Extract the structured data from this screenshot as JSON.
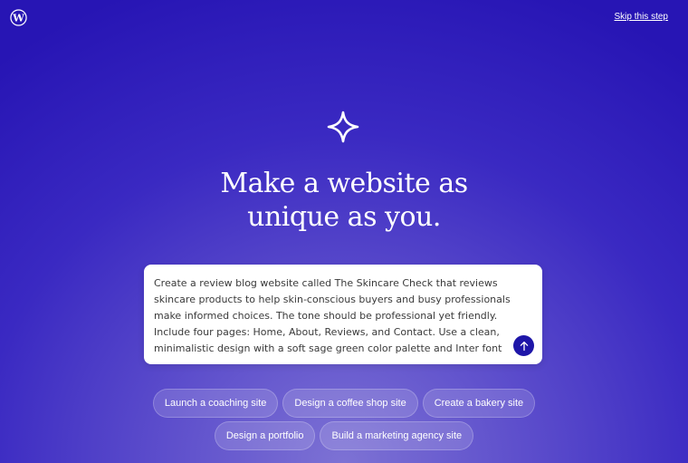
{
  "header": {
    "logo_icon": "wordpress-logo-icon",
    "skip_label": "Skip this step"
  },
  "hero": {
    "icon": "sparkle-icon",
    "headline_line1": "Make a website as",
    "headline_line2": "unique as you."
  },
  "prompt": {
    "value": "Create a review blog website called The Skincare Check that reviews skincare products to help skin-conscious buyers and busy professionals make informed choices. The tone should be professional yet friendly. Include four pages: Home, About, Reviews, and Contact. Use a clean, minimalistic design with a soft sage green color palette and Inter font throughout the site.",
    "submit_icon": "arrow-up-icon"
  },
  "suggestions": {
    "row1": [
      {
        "label": "Launch a coaching site"
      },
      {
        "label": "Design a coffee shop site"
      },
      {
        "label": "Create a bakery site"
      }
    ],
    "row2": [
      {
        "label": "Design a portfolio"
      },
      {
        "label": "Build a marketing agency site"
      }
    ]
  },
  "colors": {
    "background_top": "#2715b4",
    "background_glow": "#7d72d4",
    "submit_button": "#1e16a8",
    "prompt_background": "#ffffff"
  }
}
